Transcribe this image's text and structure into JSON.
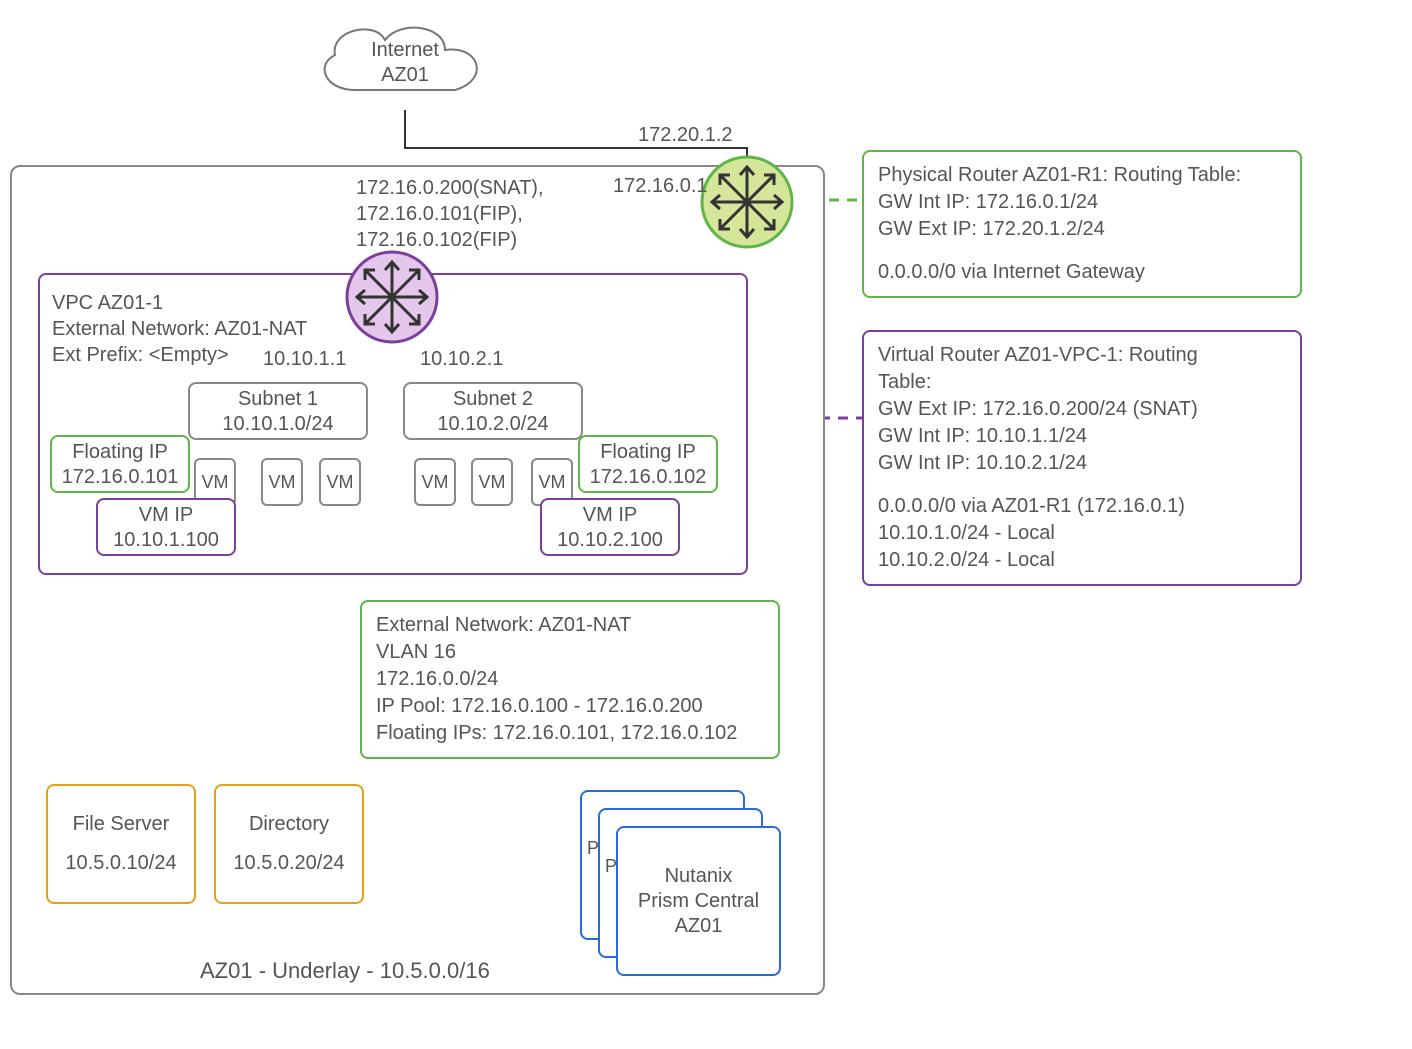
{
  "cloud": {
    "line1": "Internet",
    "line2": "AZ01"
  },
  "labels": {
    "physRouterExt": "172.20.1.2",
    "physRouterInt": "172.16.0.1",
    "vrouterExtSnat": "172.16.0.200(SNAT),",
    "vrouterExtFip1": "172.16.0.101(FIP),",
    "vrouterExtFip2": "172.16.0.102(FIP)",
    "sub1Gw": "10.10.1.1",
    "sub2Gw": "10.10.2.1",
    "underlay": "AZ01 - Underlay - 10.5.0.0/16"
  },
  "vpc": {
    "l1": "VPC AZ01-1",
    "l2": "External Network: AZ01-NAT",
    "l3": "Ext Prefix: <Empty>"
  },
  "subnet1": {
    "name": "Subnet 1",
    "cidr": "10.10.1.0/24"
  },
  "subnet2": {
    "name": "Subnet 2",
    "cidr": "10.10.2.0/24"
  },
  "vmLabel": "VM",
  "fip1": {
    "title": "Floating IP",
    "ip": "172.16.0.101"
  },
  "fip2": {
    "title": "Floating IP",
    "ip": "172.16.0.102"
  },
  "vmip1": {
    "title": "VM IP",
    "ip": "10.10.1.100"
  },
  "vmip2": {
    "title": "VM IP",
    "ip": "10.10.2.100"
  },
  "extNet": {
    "l1": "External Network: AZ01-NAT",
    "l2": "VLAN 16",
    "l3": "172.16.0.0/24",
    "l4": "IP Pool: 172.16.0.100 - 172.16.0.200",
    "l5": "Floating IPs: 172.16.0.101, 172.16.0.102"
  },
  "fileServer": {
    "name": "File Server",
    "ip": "10.5.0.10/24"
  },
  "directory": {
    "name": "Directory",
    "ip": "10.5.0.20/24"
  },
  "prism": {
    "l1": "Nutanix",
    "l2": "Prism Central",
    "l3": "AZ01",
    "p": "P"
  },
  "physRouterBox": {
    "l1": "Physical Router AZ01-R1: Routing Table:",
    "l2": "GW Int IP: 172.16.0.1/24",
    "l3": "GW Ext IP: 172.20.1.2/24",
    "l4": "0.0.0.0/0 via Internet Gateway"
  },
  "vRouterBox": {
    "l1": "Virtual Router AZ01-VPC-1: Routing",
    "l2": "Table:",
    "l3": "GW Ext IP: 172.16.0.200/24 (SNAT)",
    "l4": "GW Int IP: 10.10.1.1/24",
    "l5": "GW Int IP: 10.10.2.1/24",
    "l6": "0.0.0.0/0 via AZ01-R1 (172.16.0.1)",
    "l7": "10.10.1.0/24 - Local",
    "l8": "10.10.2.0/24 - Local"
  }
}
